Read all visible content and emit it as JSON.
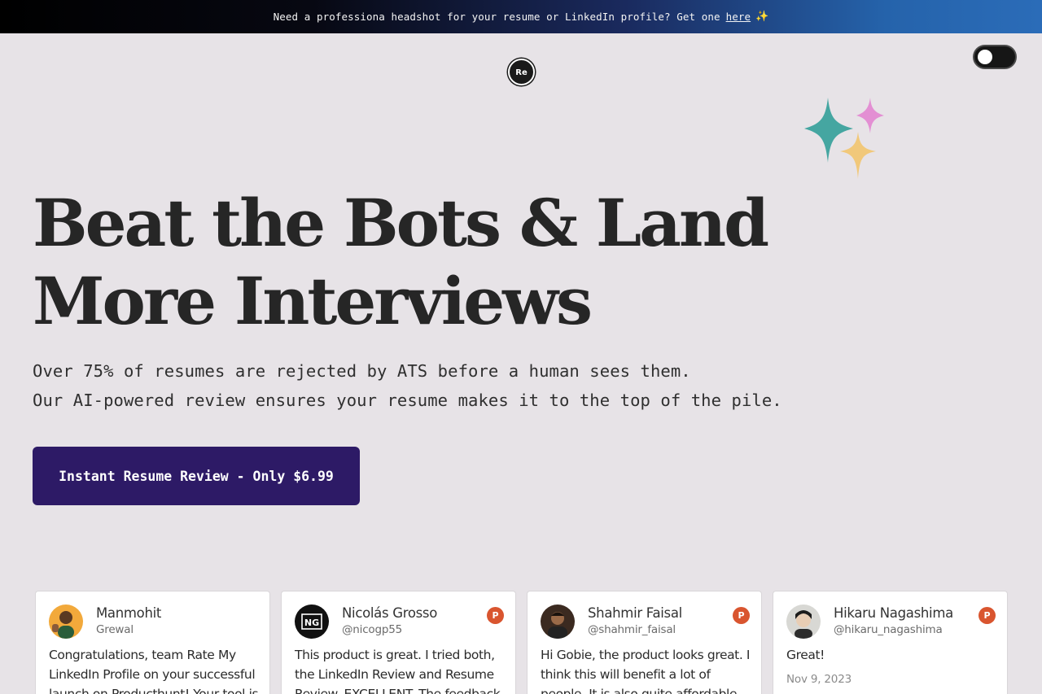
{
  "banner": {
    "text": "Need a professiona headshot for your resume or LinkedIn profile? Get one",
    "link_label": "here",
    "emoji": "✨"
  },
  "logo": {
    "label": "Re"
  },
  "theme_toggle": {
    "state": "off"
  },
  "hero": {
    "headline": "Beat the Bots & Land More Interviews",
    "subtitle_line1": "Over 75% of resumes are rejected by ATS before a human sees them.",
    "subtitle_line2": "Our AI-powered review ensures your resume makes it to the top of the pile.",
    "cta_label": "Instant Resume Review - Only $6.99"
  },
  "colors": {
    "background": "#e7e3e7",
    "cta": "#2d1a66",
    "producthunt": "#d9552f",
    "sparkle_teal": "#45a6a1",
    "sparkle_pink": "#e38fd3",
    "sparkle_yellow": "#f1c87a"
  },
  "testimonials": [
    {
      "name": "Manmohit",
      "handle": "Grewal",
      "text": "Congratulations, team Rate My LinkedIn Profile on your successful launch on Producthunt! Your tool is a",
      "badge": "",
      "date": ""
    },
    {
      "name": "Nicolás Grosso",
      "handle": "@nicogp55",
      "text": "This product is great. I tried both, the LinkedIn Review and Resume Review. EXCELLENT. The feedback is",
      "badge": "P",
      "date": ""
    },
    {
      "name": "Shahmir Faisal",
      "handle": "@shahmir_faisal",
      "text": "Hi Gobie, the product looks great. I think this will benefit a lot of people. It is also quite affordable for a lot of",
      "badge": "P",
      "date": ""
    },
    {
      "name": "Hikaru Nagashima",
      "handle": "@hikaru_nagashima",
      "text": "Great!",
      "badge": "P",
      "date": "Nov 9, 2023"
    }
  ]
}
